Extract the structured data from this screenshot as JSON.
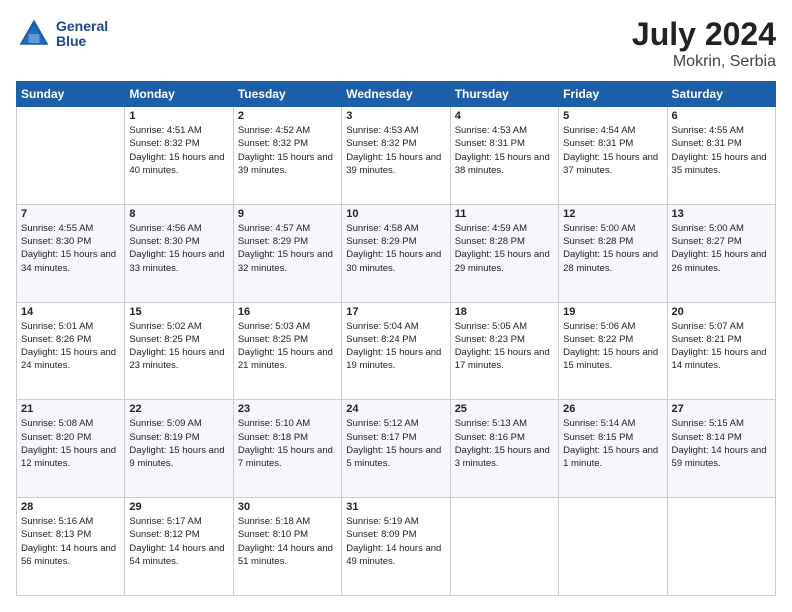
{
  "header": {
    "logo_line1": "General",
    "logo_line2": "Blue",
    "month_year": "July 2024",
    "location": "Mokrin, Serbia"
  },
  "weekdays": [
    "Sunday",
    "Monday",
    "Tuesday",
    "Wednesday",
    "Thursday",
    "Friday",
    "Saturday"
  ],
  "weeks": [
    [
      {
        "day": "",
        "sunrise": "",
        "sunset": "",
        "daylight": ""
      },
      {
        "day": "1",
        "sunrise": "Sunrise: 4:51 AM",
        "sunset": "Sunset: 8:32 PM",
        "daylight": "Daylight: 15 hours and 40 minutes."
      },
      {
        "day": "2",
        "sunrise": "Sunrise: 4:52 AM",
        "sunset": "Sunset: 8:32 PM",
        "daylight": "Daylight: 15 hours and 39 minutes."
      },
      {
        "day": "3",
        "sunrise": "Sunrise: 4:53 AM",
        "sunset": "Sunset: 8:32 PM",
        "daylight": "Daylight: 15 hours and 39 minutes."
      },
      {
        "day": "4",
        "sunrise": "Sunrise: 4:53 AM",
        "sunset": "Sunset: 8:31 PM",
        "daylight": "Daylight: 15 hours and 38 minutes."
      },
      {
        "day": "5",
        "sunrise": "Sunrise: 4:54 AM",
        "sunset": "Sunset: 8:31 PM",
        "daylight": "Daylight: 15 hours and 37 minutes."
      },
      {
        "day": "6",
        "sunrise": "Sunrise: 4:55 AM",
        "sunset": "Sunset: 8:31 PM",
        "daylight": "Daylight: 15 hours and 35 minutes."
      }
    ],
    [
      {
        "day": "7",
        "sunrise": "Sunrise: 4:55 AM",
        "sunset": "Sunset: 8:30 PM",
        "daylight": "Daylight: 15 hours and 34 minutes."
      },
      {
        "day": "8",
        "sunrise": "Sunrise: 4:56 AM",
        "sunset": "Sunset: 8:30 PM",
        "daylight": "Daylight: 15 hours and 33 minutes."
      },
      {
        "day": "9",
        "sunrise": "Sunrise: 4:57 AM",
        "sunset": "Sunset: 8:29 PM",
        "daylight": "Daylight: 15 hours and 32 minutes."
      },
      {
        "day": "10",
        "sunrise": "Sunrise: 4:58 AM",
        "sunset": "Sunset: 8:29 PM",
        "daylight": "Daylight: 15 hours and 30 minutes."
      },
      {
        "day": "11",
        "sunrise": "Sunrise: 4:59 AM",
        "sunset": "Sunset: 8:28 PM",
        "daylight": "Daylight: 15 hours and 29 minutes."
      },
      {
        "day": "12",
        "sunrise": "Sunrise: 5:00 AM",
        "sunset": "Sunset: 8:28 PM",
        "daylight": "Daylight: 15 hours and 28 minutes."
      },
      {
        "day": "13",
        "sunrise": "Sunrise: 5:00 AM",
        "sunset": "Sunset: 8:27 PM",
        "daylight": "Daylight: 15 hours and 26 minutes."
      }
    ],
    [
      {
        "day": "14",
        "sunrise": "Sunrise: 5:01 AM",
        "sunset": "Sunset: 8:26 PM",
        "daylight": "Daylight: 15 hours and 24 minutes."
      },
      {
        "day": "15",
        "sunrise": "Sunrise: 5:02 AM",
        "sunset": "Sunset: 8:25 PM",
        "daylight": "Daylight: 15 hours and 23 minutes."
      },
      {
        "day": "16",
        "sunrise": "Sunrise: 5:03 AM",
        "sunset": "Sunset: 8:25 PM",
        "daylight": "Daylight: 15 hours and 21 minutes."
      },
      {
        "day": "17",
        "sunrise": "Sunrise: 5:04 AM",
        "sunset": "Sunset: 8:24 PM",
        "daylight": "Daylight: 15 hours and 19 minutes."
      },
      {
        "day": "18",
        "sunrise": "Sunrise: 5:05 AM",
        "sunset": "Sunset: 8:23 PM",
        "daylight": "Daylight: 15 hours and 17 minutes."
      },
      {
        "day": "19",
        "sunrise": "Sunrise: 5:06 AM",
        "sunset": "Sunset: 8:22 PM",
        "daylight": "Daylight: 15 hours and 15 minutes."
      },
      {
        "day": "20",
        "sunrise": "Sunrise: 5:07 AM",
        "sunset": "Sunset: 8:21 PM",
        "daylight": "Daylight: 15 hours and 14 minutes."
      }
    ],
    [
      {
        "day": "21",
        "sunrise": "Sunrise: 5:08 AM",
        "sunset": "Sunset: 8:20 PM",
        "daylight": "Daylight: 15 hours and 12 minutes."
      },
      {
        "day": "22",
        "sunrise": "Sunrise: 5:09 AM",
        "sunset": "Sunset: 8:19 PM",
        "daylight": "Daylight: 15 hours and 9 minutes."
      },
      {
        "day": "23",
        "sunrise": "Sunrise: 5:10 AM",
        "sunset": "Sunset: 8:18 PM",
        "daylight": "Daylight: 15 hours and 7 minutes."
      },
      {
        "day": "24",
        "sunrise": "Sunrise: 5:12 AM",
        "sunset": "Sunset: 8:17 PM",
        "daylight": "Daylight: 15 hours and 5 minutes."
      },
      {
        "day": "25",
        "sunrise": "Sunrise: 5:13 AM",
        "sunset": "Sunset: 8:16 PM",
        "daylight": "Daylight: 15 hours and 3 minutes."
      },
      {
        "day": "26",
        "sunrise": "Sunrise: 5:14 AM",
        "sunset": "Sunset: 8:15 PM",
        "daylight": "Daylight: 15 hours and 1 minute."
      },
      {
        "day": "27",
        "sunrise": "Sunrise: 5:15 AM",
        "sunset": "Sunset: 8:14 PM",
        "daylight": "Daylight: 14 hours and 59 minutes."
      }
    ],
    [
      {
        "day": "28",
        "sunrise": "Sunrise: 5:16 AM",
        "sunset": "Sunset: 8:13 PM",
        "daylight": "Daylight: 14 hours and 56 minutes."
      },
      {
        "day": "29",
        "sunrise": "Sunrise: 5:17 AM",
        "sunset": "Sunset: 8:12 PM",
        "daylight": "Daylight: 14 hours and 54 minutes."
      },
      {
        "day": "30",
        "sunrise": "Sunrise: 5:18 AM",
        "sunset": "Sunset: 8:10 PM",
        "daylight": "Daylight: 14 hours and 51 minutes."
      },
      {
        "day": "31",
        "sunrise": "Sunrise: 5:19 AM",
        "sunset": "Sunset: 8:09 PM",
        "daylight": "Daylight: 14 hours and 49 minutes."
      },
      {
        "day": "",
        "sunrise": "",
        "sunset": "",
        "daylight": ""
      },
      {
        "day": "",
        "sunrise": "",
        "sunset": "",
        "daylight": ""
      },
      {
        "day": "",
        "sunrise": "",
        "sunset": "",
        "daylight": ""
      }
    ]
  ]
}
